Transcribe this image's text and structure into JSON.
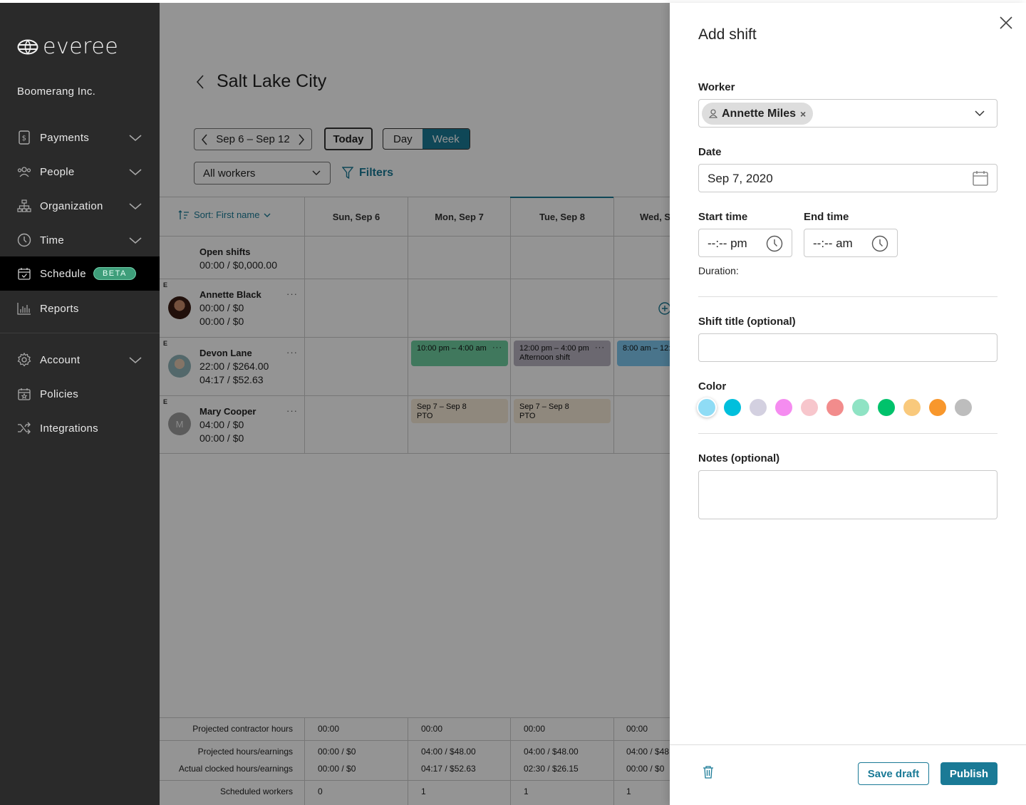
{
  "brand": {
    "name": "everee",
    "company": "Boomerang Inc."
  },
  "nav": {
    "payments": "Payments",
    "people": "People",
    "organization": "Organization",
    "time": "Time",
    "schedule": "Schedule",
    "beta": "BETA",
    "reports": "Reports",
    "account": "Account",
    "policies": "Policies",
    "integrations": "Integrations"
  },
  "header": {
    "title": "Salt Lake City",
    "date_range": "Sep 6 – Sep 12",
    "today": "Today",
    "day": "Day",
    "week": "Week",
    "workers_select": "All workers",
    "filters": "Filters"
  },
  "grid": {
    "sort": "Sort: First name",
    "days": [
      "Sun, Sep 6",
      "Mon, Sep 7",
      "Tue, Sep 8",
      "Wed, S"
    ],
    "open_shifts": {
      "title": "Open shifts",
      "value": "00:00 / $0,000.00"
    },
    "workers": [
      {
        "tag": "E",
        "name": "Annette Black",
        "line1": "00:00 / $0",
        "line2": "00:00 / $0"
      },
      {
        "tag": "E",
        "name": "Devon Lane",
        "line1": "22:00 / $264.00",
        "line2": "04:17 / $52.63"
      },
      {
        "tag": "E",
        "name": "Mary Cooper",
        "initial": "M",
        "line1": "04:00 / $0",
        "line2": "00:00 / $0"
      }
    ],
    "shifts": {
      "devon_mon": {
        "time": "10:00 pm – 4:00 am",
        "dots": "···"
      },
      "devon_tue": {
        "time": "12:00 pm – 4:00 pm",
        "title": "Afternoon shift",
        "dots": "···"
      },
      "devon_wed": {
        "time": "8:00 am – 12:"
      },
      "mary_mon": {
        "range": "Sep 7 – Sep 8",
        "type": "PTO"
      },
      "mary_tue": {
        "range": "Sep 7 – Sep 8",
        "type": "PTO"
      }
    },
    "footer": {
      "projected_contractor": "Projected contractor hours",
      "projected_hours": "Projected hours/earnings",
      "actual_hours": "Actual clocked hours/earnings",
      "scheduled": "Scheduled workers",
      "cols": [
        {
          "contractor": "00:00",
          "proj": "00:00 / $0",
          "actual": "00:00 / $0",
          "sched": "0"
        },
        {
          "contractor": "00:00",
          "proj": "04:00 / $48.00",
          "actual": "04:17 / $52.63",
          "sched": "1"
        },
        {
          "contractor": "00:00",
          "proj": "04:00 / $48.00",
          "actual": "02:30 / $26.15",
          "sched": "1"
        },
        {
          "contractor": "00:00",
          "proj": "04:00 / $48",
          "actual": "00:00 / $0",
          "sched": "1"
        }
      ]
    }
  },
  "panel": {
    "title": "Add shift",
    "worker_label": "Worker",
    "worker_value": "Annette Miles",
    "chip_remove": "×",
    "date_label": "Date",
    "date_value": "Sep 7, 2020",
    "start_label": "Start time",
    "start_value": "--:-- pm",
    "end_label": "End time",
    "end_value": "--:-- am",
    "duration_label": "Duration:",
    "shift_title_label": "Shift title (optional)",
    "color_label": "Color",
    "colors": [
      "#8fdcf5",
      "#00bfdc",
      "#d3d0e0",
      "#f58cf0",
      "#f7c6cc",
      "#f28c8c",
      "#8fe3c4",
      "#00c26b",
      "#f9c97c",
      "#f8972c",
      "#bdbdbd"
    ],
    "notes_label": "Notes (optional)",
    "save_draft": "Save draft",
    "publish": "Publish"
  }
}
